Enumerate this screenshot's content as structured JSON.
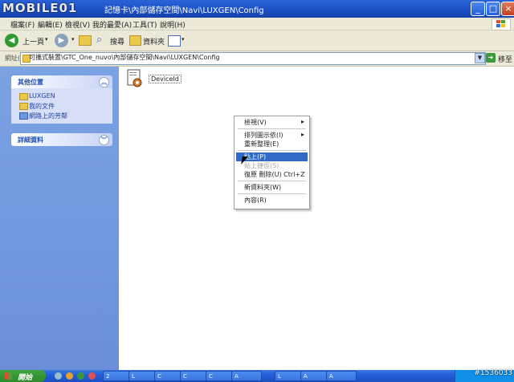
{
  "watermark": "MOBILE01",
  "window": {
    "title": "記憶卡\\內部儲存空間\\Navi\\LUXGEN\\Config"
  },
  "menu": [
    "檔案(F)",
    "編輯(E)",
    "檢視(V)",
    "我的最愛(A)",
    "工具(T)",
    "說明(H)"
  ],
  "toolbar": {
    "back": "上一頁",
    "search": "搜尋",
    "folders": "資料夾"
  },
  "address": {
    "label": "網址(D)",
    "value": "可攜式裝置\\GTC_One_nuvo\\內部儲存空間\\Navi\\LUXGEN\\Config",
    "go": "移至"
  },
  "left_pane": {
    "other_places": {
      "header": "其他位置",
      "links": [
        "LUXGEN",
        "我的文件",
        "網路上的芳鄰"
      ]
    },
    "details": {
      "header": "詳細資料"
    }
  },
  "file": {
    "name": "DeviceId"
  },
  "context_menu": {
    "items": [
      {
        "label": "檢視(V)",
        "submenu": true
      },
      {
        "label": "排列圖示依(I)",
        "submenu": true
      },
      {
        "label": "重新整理(E)"
      },
      {
        "label": "貼上(P)",
        "selected": true
      },
      {
        "label": "貼上捷徑(S)",
        "disabled": true
      },
      {
        "label": "復原 刪除(U)   Ctrl+Z"
      },
      {
        "label": "新資料夾(W)"
      },
      {
        "label": "內容(R)"
      }
    ]
  },
  "taskbar": {
    "start": "開始",
    "tasks": [
      "2",
      "L",
      "C",
      "C",
      "C",
      "A",
      "L",
      "A",
      "A"
    ]
  },
  "watermark2": "#1536033"
}
